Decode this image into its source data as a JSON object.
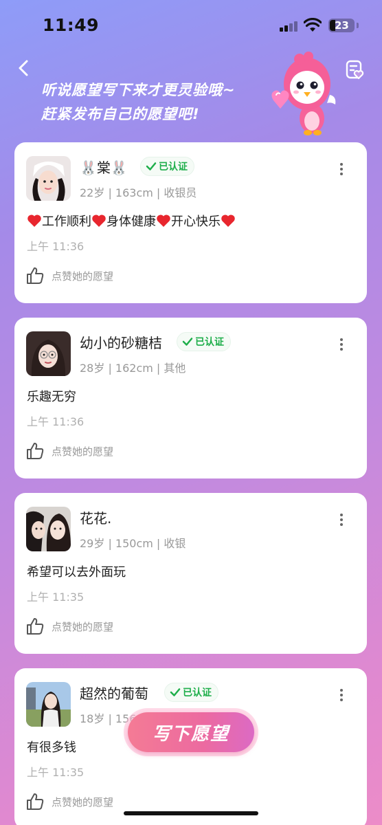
{
  "status_bar": {
    "time": "11:49",
    "battery": "23"
  },
  "header": {
    "banner_line1": "听说愿望写下来才更灵验哦~",
    "banner_line2": "赶紧发布自己的愿望吧!"
  },
  "posts": [
    {
      "name": "🐰棠🐰",
      "verified": "已认证",
      "meta": "22岁 | 163cm | 收银员",
      "wish_segments": [
        "工作顺利",
        "身体健康",
        "开心快乐"
      ],
      "time": "上午 11:36",
      "like_label": "点赞她的愿望"
    },
    {
      "name": "幼小的砂糖桔",
      "verified": "已认证",
      "meta": "28岁 | 162cm | 其他",
      "wish": "乐趣无穷",
      "time": "上午 11:36",
      "like_label": "点赞她的愿望"
    },
    {
      "name": "花花.",
      "meta": "29岁 | 150cm | 收银",
      "wish": "希望可以去外面玩",
      "time": "上午 11:35",
      "like_label": "点赞她的愿望"
    },
    {
      "name": "超然的葡萄",
      "verified": "已认证",
      "meta": "18岁 | 156",
      "wish": "有很多钱",
      "time": "上午 11:35",
      "like_label": "点赞她的愿望"
    }
  ],
  "cta": {
    "label": "写下愿望"
  },
  "colors": {
    "accent_pink": "#ec6aa0",
    "verified_green": "#1eae4a",
    "heart_red": "#e8262e"
  }
}
